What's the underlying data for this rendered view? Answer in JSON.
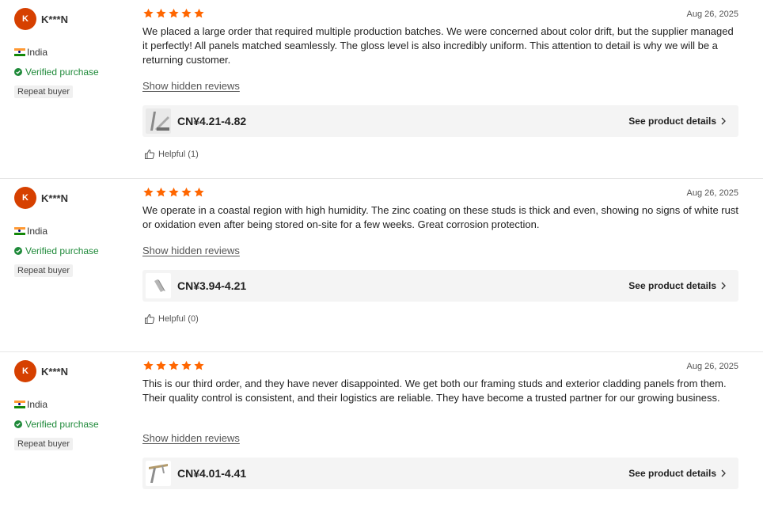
{
  "colors": {
    "star": "#ff6600",
    "verified": "#1f8a3a",
    "avatar": "#d64000"
  },
  "reviews": [
    {
      "avatar_initial": "K",
      "username": "K***N",
      "country": "India",
      "verified": "Verified purchase",
      "badge": "Repeat buyer",
      "rating": 5,
      "date": "Aug 26, 2025",
      "text": "We placed a large order that required multiple production batches. We were concerned about color drift, but the supplier managed it perfectly! All panels matched seamlessly. The gloss level is also incredibly uniform. This attention to detail is why we will be a returning customer.",
      "show_hidden": "Show hidden reviews",
      "product": {
        "price": "CN¥4.21-4.82",
        "details_label": "See product details",
        "thumb_icon": "steel-stud-icon"
      },
      "helpful": "Helpful (1)"
    },
    {
      "avatar_initial": "K",
      "username": "K***N",
      "country": "India",
      "verified": "Verified purchase",
      "badge": "Repeat buyer",
      "rating": 5,
      "date": "Aug 26, 2025",
      "text": "We operate in a coastal region with high humidity. The zinc coating on these studs is thick and even, showing no signs of white rust or oxidation even after being stored on-site for a few weeks. Great corrosion protection.",
      "show_hidden": "Show hidden reviews",
      "product": {
        "price": "CN¥3.94-4.21",
        "details_label": "See product details",
        "thumb_icon": "metal-profile-icon"
      },
      "helpful": "Helpful (0)"
    },
    {
      "avatar_initial": "K",
      "username": "K***N",
      "country": "India",
      "verified": "Verified purchase",
      "badge": "Repeat buyer",
      "rating": 5,
      "date": "Aug 26, 2025",
      "text": "This is our third order, and they have never disappointed. We get both our framing studs and exterior cladding panels from them. Their quality control is consistent, and their logistics are reliable. They have become a trusted partner for our growing business.",
      "show_hidden": "Show hidden reviews",
      "product": {
        "price": "CN¥4.01-4.41",
        "details_label": "See product details",
        "thumb_icon": "framing-stud-icon"
      }
    }
  ]
}
